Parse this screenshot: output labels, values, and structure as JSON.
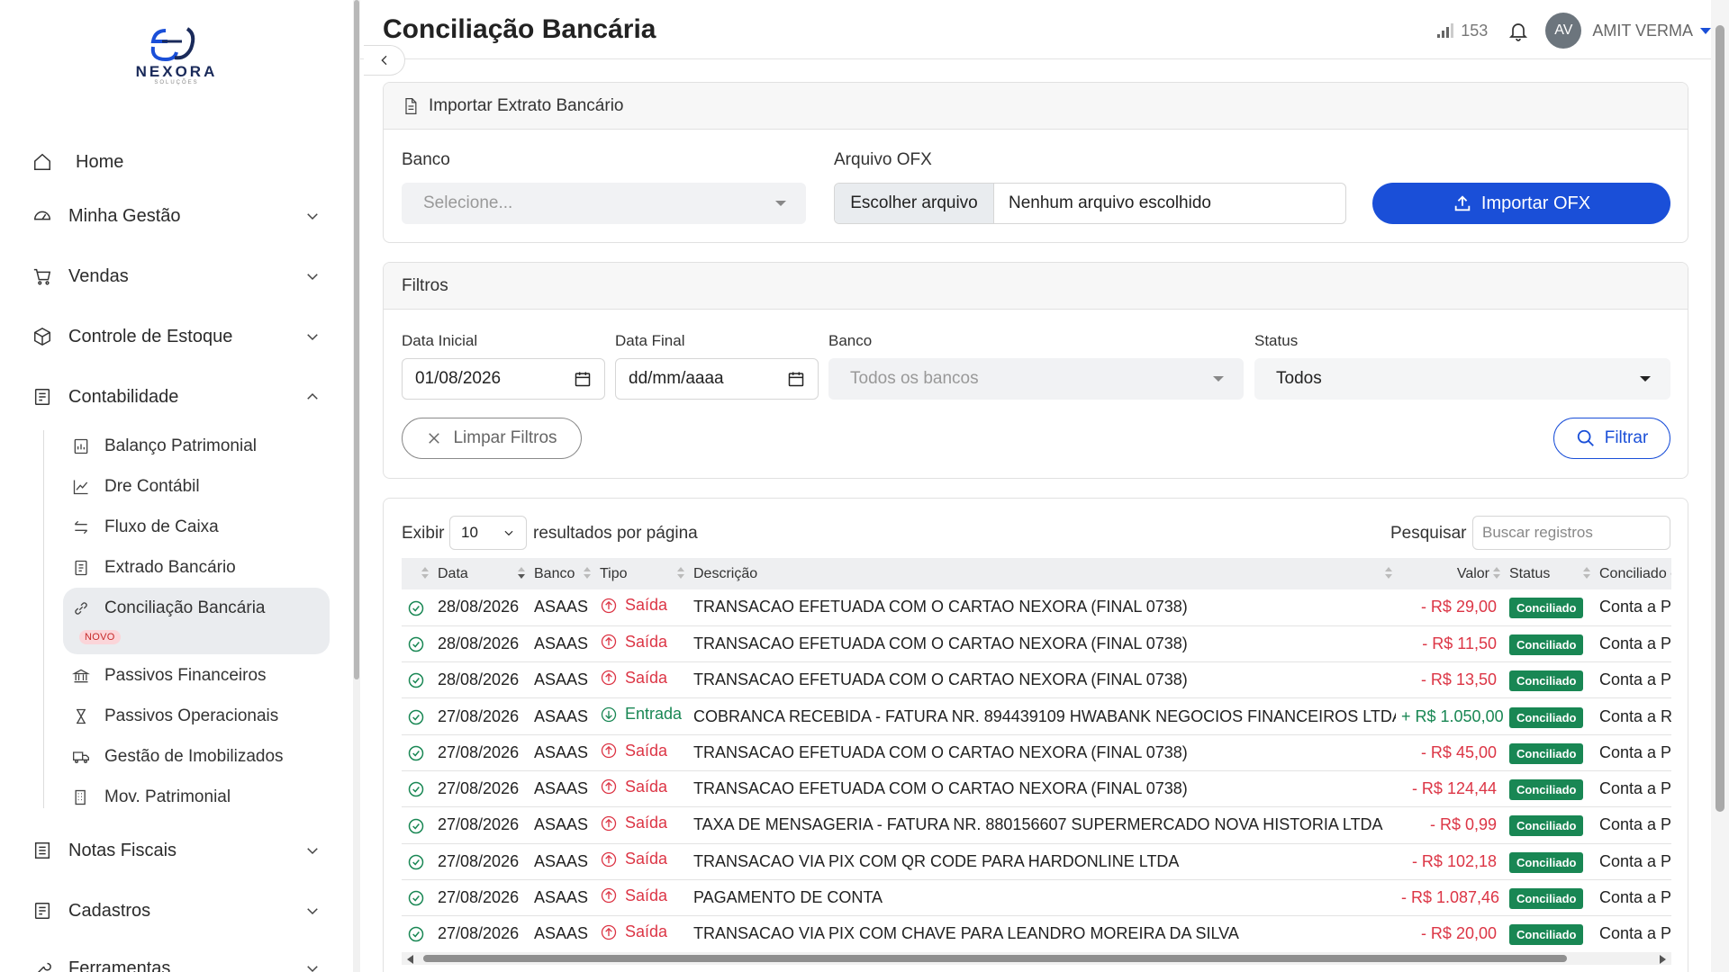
{
  "brand": {
    "name": "NEXORA",
    "tagline": "SOLUÇÕES"
  },
  "sidebar": {
    "items": [
      {
        "label": "Home"
      },
      {
        "label": "Minha Gestão"
      },
      {
        "label": "Vendas"
      },
      {
        "label": "Controle de Estoque"
      },
      {
        "label": "Contabilidade"
      },
      {
        "label": "Notas Fiscais"
      },
      {
        "label": "Cadastros"
      },
      {
        "label": "Ferramentas"
      }
    ],
    "sub_items": [
      {
        "label": "Balanço Patrimonial"
      },
      {
        "label": "Dre Contábil"
      },
      {
        "label": "Fluxo de Caixa"
      },
      {
        "label": "Extrado Bancário"
      },
      {
        "label": "Conciliação Bancária",
        "badge": "NOVO"
      },
      {
        "label": "Passivos Financeiros"
      },
      {
        "label": "Passivos Operacionais"
      },
      {
        "label": "Gestão de Imobilizados"
      },
      {
        "label": "Mov. Patrimonial"
      }
    ]
  },
  "header": {
    "title": "Conciliação Bancária",
    "signal_count": "153",
    "avatar_initials": "AV",
    "user_name": "AMIT VERMA"
  },
  "import_card": {
    "title": "Importar Extrato Bancário",
    "bank_label": "Banco",
    "bank_placeholder": "Selecione...",
    "file_label": "Arquivo OFX",
    "file_button": "Escolher arquivo",
    "file_status": "Nenhum arquivo escolhido",
    "import_button": "Importar OFX"
  },
  "filters": {
    "title": "Filtros",
    "start_label": "Data Inicial",
    "start_value": "01/08/2026",
    "end_label": "Data Final",
    "end_placeholder": "dd/mm/aaaa",
    "bank_label": "Banco",
    "bank_placeholder": "Todos os bancos",
    "status_label": "Status",
    "status_value": "Todos",
    "clear_button": "Limpar Filtros",
    "filter_button": "Filtrar"
  },
  "table_controls": {
    "show_label": "Exibir",
    "page_size": "10",
    "per_page_label": "resultados por página",
    "search_label": "Pesquisar",
    "search_placeholder": "Buscar registros"
  },
  "table": {
    "columns": [
      "Data",
      "Banco",
      "Tipo",
      "Descrição",
      "Valor",
      "Status",
      "Conciliado co"
    ],
    "rows": [
      {
        "data": "28/08/2026",
        "banco": "ASAAS",
        "tipo": "Saída",
        "descricao": "TRANSACAO EFETUADA COM O CARTAO NEXORA (FINAL 0738)",
        "valor": "- R$ 29,00",
        "status": "Conciliado",
        "conciliado": "Conta a Pa"
      },
      {
        "data": "28/08/2026",
        "banco": "ASAAS",
        "tipo": "Saída",
        "descricao": "TRANSACAO EFETUADA COM O CARTAO NEXORA (FINAL 0738)",
        "valor": "- R$ 11,50",
        "status": "Conciliado",
        "conciliado": "Conta a Pa"
      },
      {
        "data": "28/08/2026",
        "banco": "ASAAS",
        "tipo": "Saída",
        "descricao": "TRANSACAO EFETUADA COM O CARTAO NEXORA (FINAL 0738)",
        "valor": "- R$ 13,50",
        "status": "Conciliado",
        "conciliado": "Conta a Pa"
      },
      {
        "data": "27/08/2026",
        "banco": "ASAAS",
        "tipo": "Entrada",
        "descricao": "COBRANCA RECEBIDA - FATURA NR. 894439109 HWABANK NEGOCIOS FINANCEIROS LTDA",
        "valor": "+ R$ 1.050,00",
        "status": "Conciliado",
        "conciliado": "Conta a Re"
      },
      {
        "data": "27/08/2026",
        "banco": "ASAAS",
        "tipo": "Saída",
        "descricao": "TRANSACAO EFETUADA COM O CARTAO NEXORA (FINAL 0738)",
        "valor": "- R$ 45,00",
        "status": "Conciliado",
        "conciliado": "Conta a Pa"
      },
      {
        "data": "27/08/2026",
        "banco": "ASAAS",
        "tipo": "Saída",
        "descricao": "TRANSACAO EFETUADA COM O CARTAO NEXORA (FINAL 0738)",
        "valor": "- R$ 124,44",
        "status": "Conciliado",
        "conciliado": "Conta a Pa"
      },
      {
        "data": "27/08/2026",
        "banco": "ASAAS",
        "tipo": "Saída",
        "descricao": "TAXA DE MENSAGERIA - FATURA NR. 880156607 SUPERMERCADO NOVA HISTORIA LTDA",
        "valor": "- R$ 0,99",
        "status": "Conciliado",
        "conciliado": "Conta a Pa"
      },
      {
        "data": "27/08/2026",
        "banco": "ASAAS",
        "tipo": "Saída",
        "descricao": "TRANSACAO VIA PIX COM QR CODE PARA HARDONLINE LTDA",
        "valor": "- R$ 102,18",
        "status": "Conciliado",
        "conciliado": "Conta a Pa"
      },
      {
        "data": "27/08/2026",
        "banco": "ASAAS",
        "tipo": "Saída",
        "descricao": "PAGAMENTO DE CONTA",
        "valor": "- R$ 1.087,46",
        "status": "Conciliado",
        "conciliado": "Conta a Pa"
      },
      {
        "data": "27/08/2026",
        "banco": "ASAAS",
        "tipo": "Saída",
        "descricao": "TRANSACAO VIA PIX COM CHAVE PARA LEANDRO MOREIRA DA SILVA",
        "valor": "- R$ 20,00",
        "status": "Conciliado",
        "conciliado": "Conta a Pa"
      }
    ]
  },
  "colors": {
    "primary": "#1a4fd8",
    "success": "#198754",
    "danger": "#dc3545"
  }
}
